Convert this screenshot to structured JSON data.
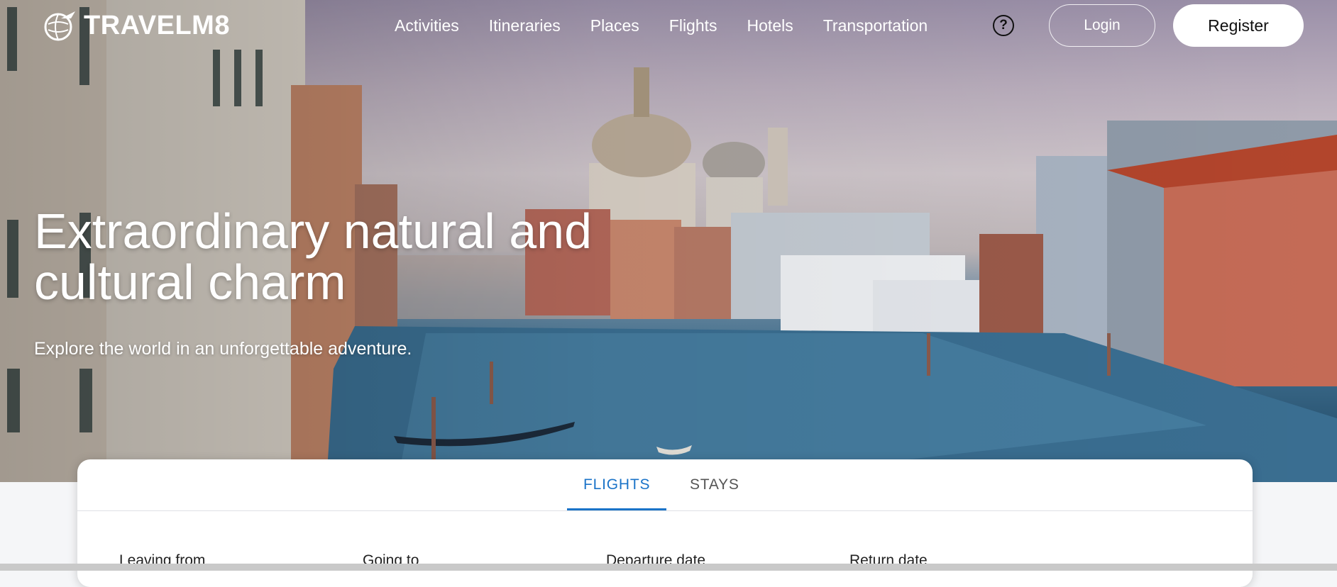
{
  "brand": {
    "name": "TRAVELM8",
    "logo_icon": "globe-plane-icon"
  },
  "nav": {
    "links": [
      "Activities",
      "Itineraries",
      "Places",
      "Flights",
      "Hotels",
      "Transportation"
    ],
    "help_icon": "question-circle-icon",
    "help_glyph": "?",
    "login_label": "Login",
    "register_label": "Register"
  },
  "hero": {
    "title": "Extraordinary natural and cultural charm",
    "subtitle": "Explore the world in an unforgettable adventure."
  },
  "search": {
    "tabs": [
      "FLIGHTS",
      "STAYS"
    ],
    "active_tab": "FLIGHTS",
    "fields": [
      "Leaving from",
      "Going to",
      "Departure date",
      "Return date"
    ]
  },
  "colors": {
    "accent": "#1a73c8",
    "card_bg": "#ffffff",
    "page_bg": "#f5f6f8"
  }
}
